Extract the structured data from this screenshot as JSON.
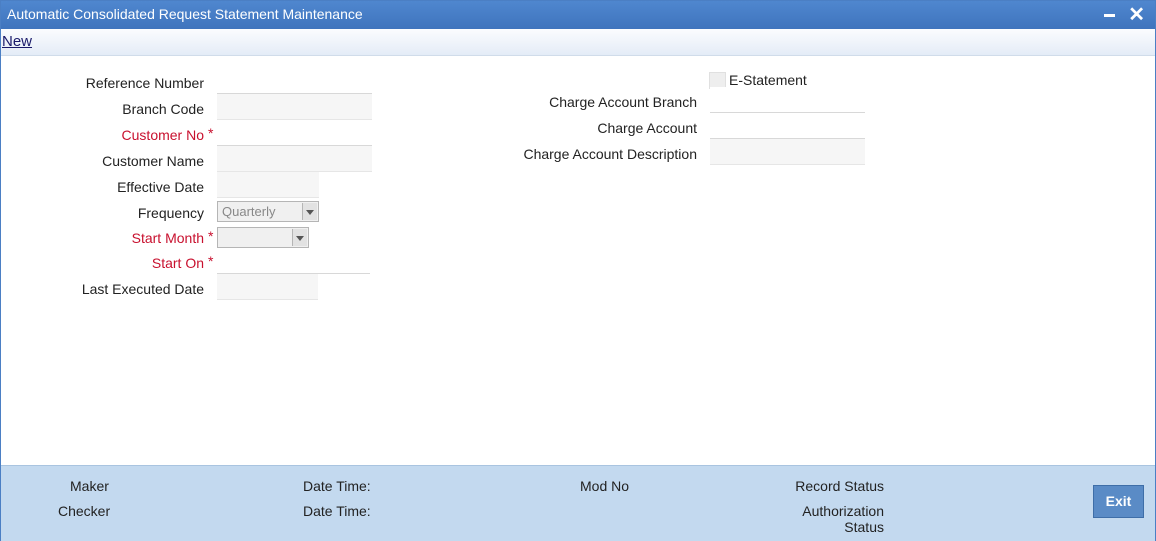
{
  "window": {
    "title": "Automatic Consolidated Request Statement Maintenance",
    "close_glyph": "✕"
  },
  "toolbar": {
    "new_label": "New"
  },
  "form": {
    "reference_number_label": "Reference Number",
    "branch_code_label": "Branch Code",
    "customer_no_label": "Customer No",
    "customer_name_label": "Customer Name",
    "effective_date_label": "Effective Date",
    "frequency_label": "Frequency",
    "frequency_value": "Quarterly",
    "start_month_label": "Start Month",
    "start_on_label": "Start On",
    "last_executed_date_label": "Last Executed Date",
    "required_marker": "*",
    "e_statement_label": "E-Statement",
    "e_statement_checked": false,
    "charge_account_branch_label": "Charge Account Branch",
    "charge_account_label": "Charge Account",
    "charge_account_description_label": "Charge Account Description"
  },
  "footer": {
    "maker_label": "Maker",
    "checker_label": "Checker",
    "date_time_label_1": "Date Time:",
    "date_time_label_2": "Date Time:",
    "mod_no_label": "Mod No",
    "record_status_label": "Record Status",
    "authorization_label": "Authorization",
    "status_label": "Status",
    "exit_label": "Exit"
  },
  "colors": {
    "titlebar": "#4a80c8",
    "required": "#c8102e",
    "footer": "#c3d9ef",
    "exit_button": "#5a8bc6"
  }
}
